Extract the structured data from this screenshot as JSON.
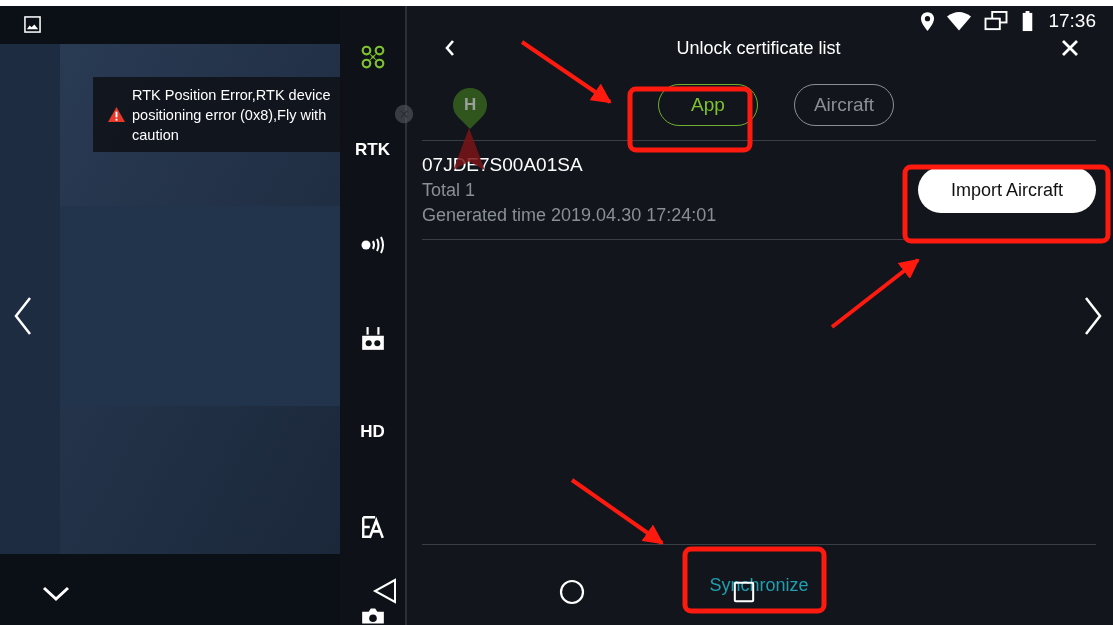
{
  "toast": {
    "message": "RTK Position Error,RTK device positioning error (0x8),Fly with caution"
  },
  "map_marker": {
    "label": "H"
  },
  "sidebar": {
    "items": [
      {
        "kind": "drone"
      },
      {
        "kind": "text",
        "label": "RTK"
      },
      {
        "kind": "signal"
      },
      {
        "kind": "remote"
      },
      {
        "kind": "text",
        "label": "HD"
      },
      {
        "kind": "translate"
      },
      {
        "kind": "camera"
      }
    ]
  },
  "status_bar": {
    "time": "17:36"
  },
  "header": {
    "title": "Unlock certificate list"
  },
  "tabs": [
    {
      "label": "App",
      "selected": true
    },
    {
      "label": "Aircraft",
      "selected": false
    }
  ],
  "certificates": [
    {
      "serial": "07JDE7S00A01SA",
      "total": "Total 1",
      "generated": "Generated time 2019.04.30 17:24:01"
    }
  ],
  "import_button": "Import Aircraft",
  "footer_button": "Synchronize"
}
